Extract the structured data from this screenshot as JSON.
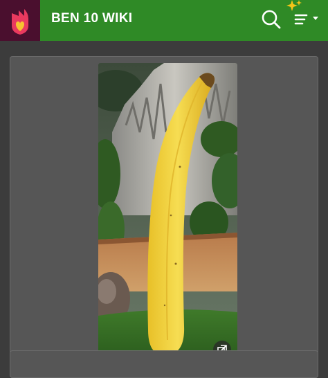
{
  "header": {
    "title": "BEN 10 WIKI",
    "logo_icon": "fandom-heart-flame-icon",
    "search_icon": "search-icon",
    "menu_icon": "sparkle-menu-icon",
    "accent_color": "#2f8a26",
    "logo_bg_color": "#4a0f2e"
  },
  "main": {
    "image_icon": "expand-image-icon"
  }
}
